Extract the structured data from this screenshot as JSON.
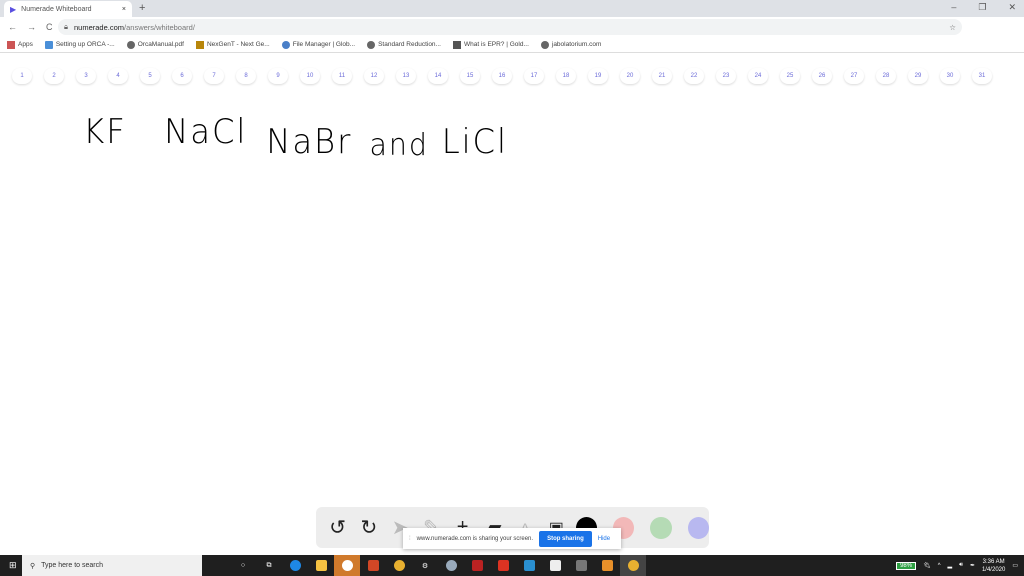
{
  "browser": {
    "tab_title": "Numerade Whiteboard",
    "url_host": "numerade.com",
    "url_path": "/answers/whiteboard/",
    "bookmarks": [
      "Apps",
      "Setting up ORCA -...",
      "OrcaManual.pdf",
      "NexGenT - Next Ge...",
      "File Manager | Glob...",
      "Standard Reduction...",
      "What is EPR? | Gold...",
      "jabolatorium.com"
    ]
  },
  "pages": [
    "1",
    "2",
    "3",
    "4",
    "5",
    "6",
    "7",
    "8",
    "9",
    "10",
    "11",
    "12",
    "13",
    "14",
    "15",
    "16",
    "17",
    "18",
    "19",
    "20",
    "21",
    "22",
    "23",
    "24",
    "25",
    "26",
    "27",
    "28",
    "29",
    "30",
    "31"
  ],
  "whiteboard": {
    "words": [
      "KF",
      "NaCl",
      "NaBr",
      "and",
      "LiCl"
    ]
  },
  "toolbar": {
    "undo": "↺",
    "redo": "↻",
    "colors": [
      "#000000",
      "#f2b8b8",
      "#b5dbb5",
      "#b8b8f0"
    ]
  },
  "share_bar": {
    "message": "www.numerade.com is sharing your screen.",
    "stop": "Stop sharing",
    "hide": "Hide"
  },
  "taskbar": {
    "search_placeholder": "Type here to search",
    "battery": "98%",
    "time": "3:36 AM",
    "date": "1/4/2020"
  }
}
